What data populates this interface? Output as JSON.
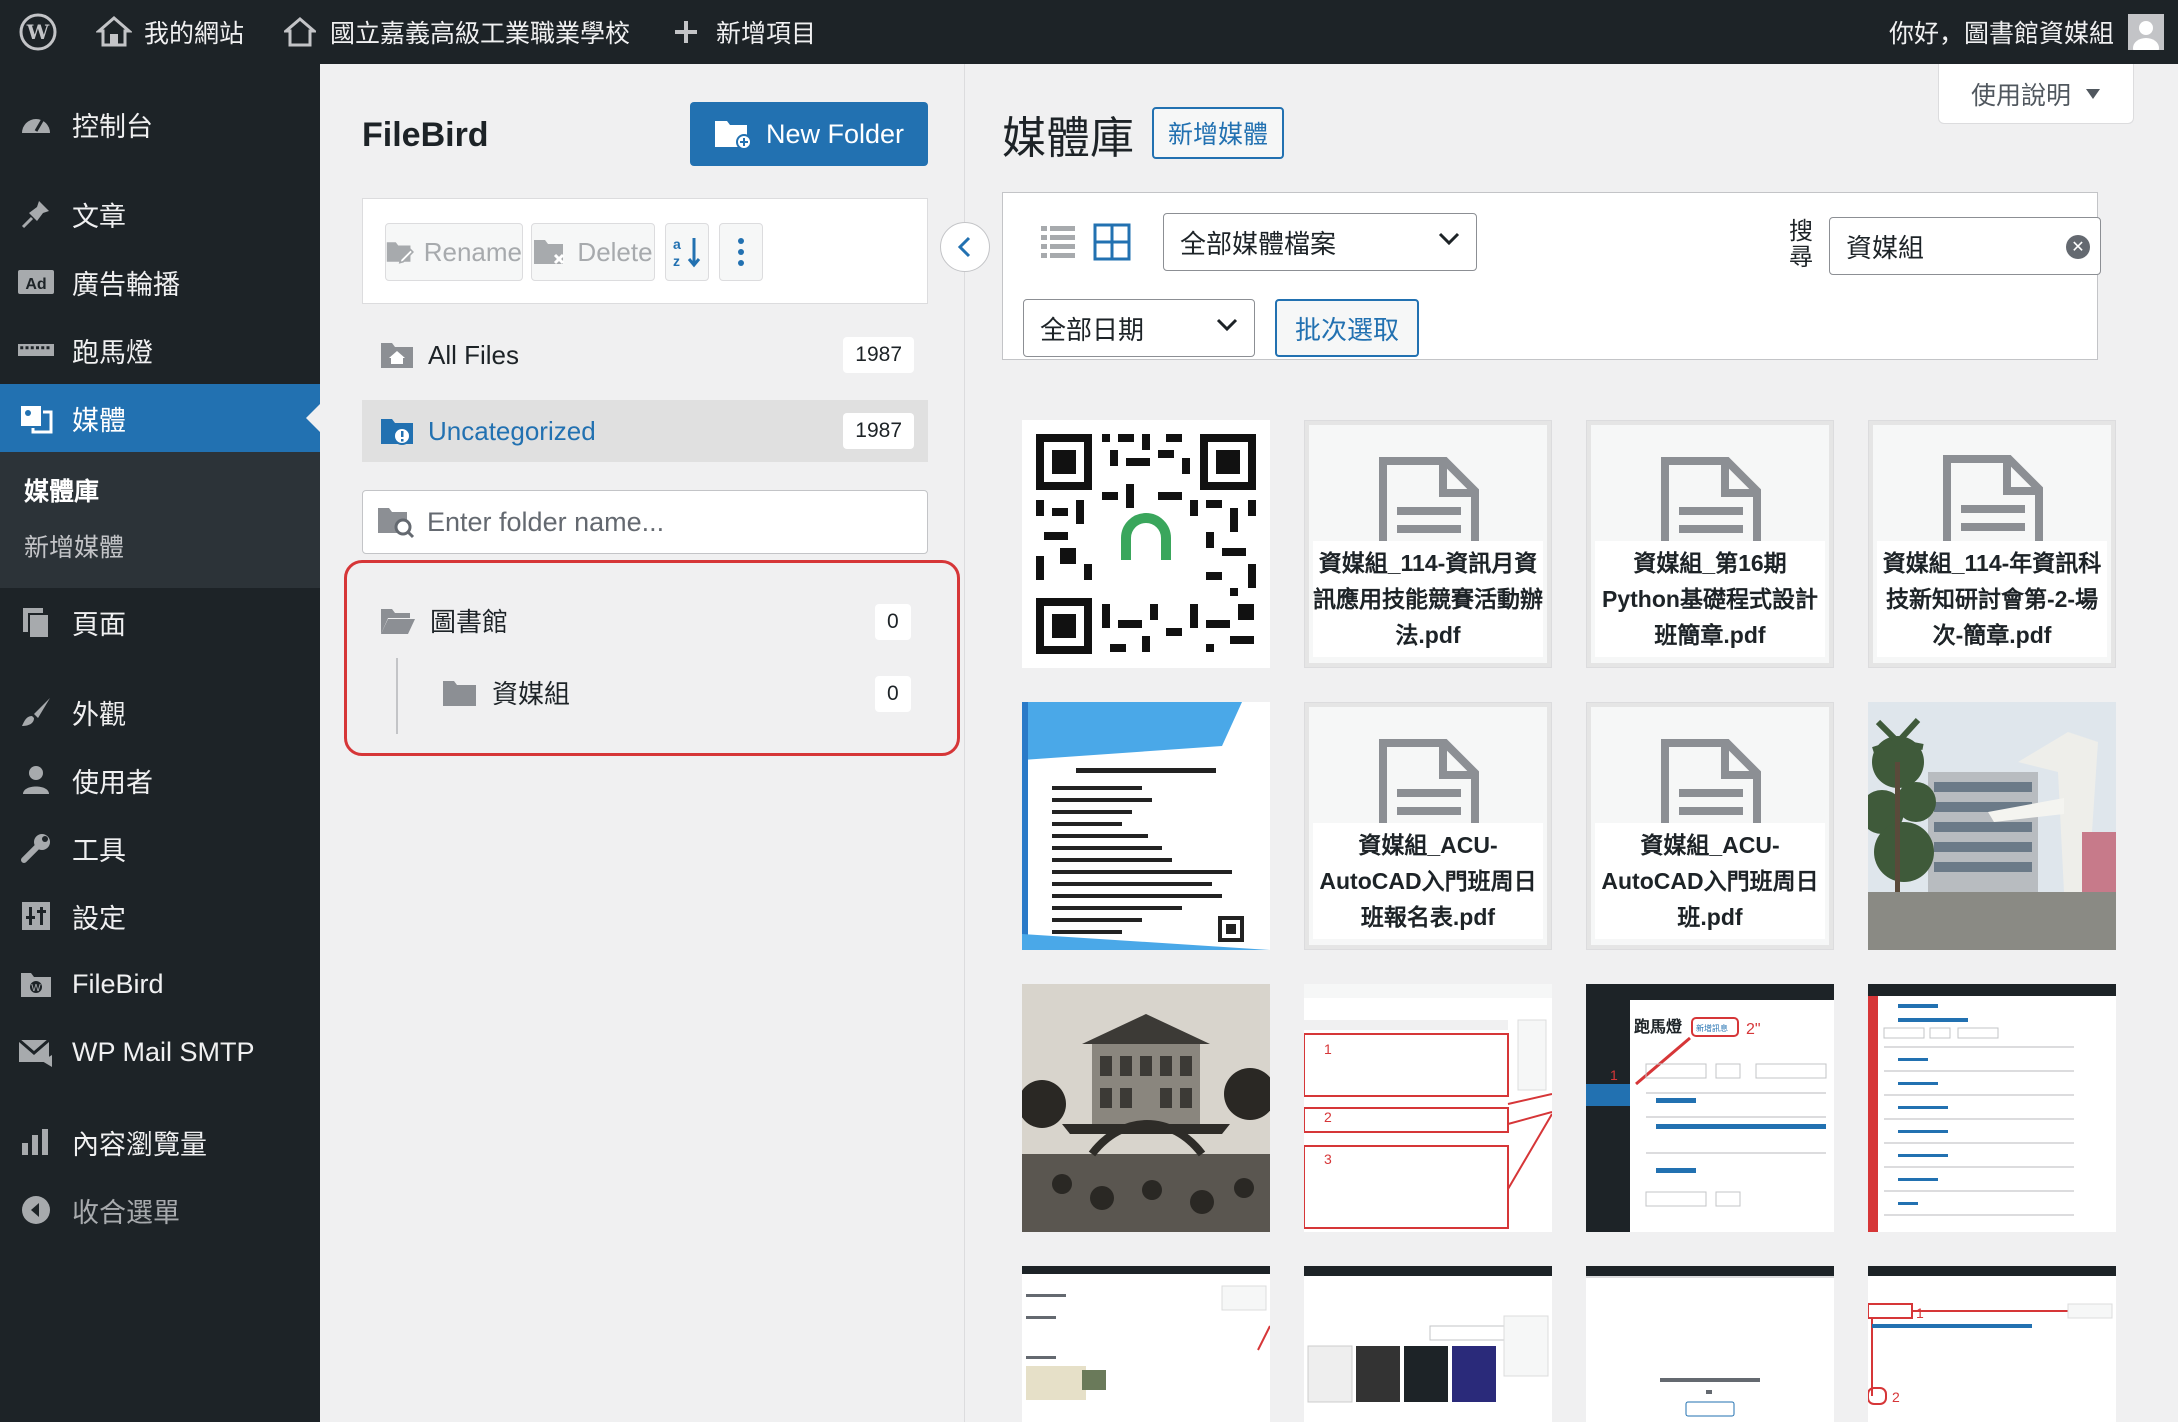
{
  "adminbar": {
    "site_name": "我的網站",
    "school_name": "國立嘉義高級工業職業學校",
    "new_item": "新增項目",
    "greeting": "你好，圖書館資媒組"
  },
  "sidebar": {
    "items": [
      {
        "label": "控制台",
        "icon": "dashboard-icon"
      },
      {
        "label": "文章",
        "icon": "pin-icon"
      },
      {
        "label": "廣告輪播",
        "icon": "ad-icon"
      },
      {
        "label": "跑馬燈",
        "icon": "marquee-icon"
      },
      {
        "label": "媒體",
        "icon": "media-icon"
      },
      {
        "label": "頁面",
        "icon": "page-icon"
      },
      {
        "label": "外觀",
        "icon": "brush-icon"
      },
      {
        "label": "使用者",
        "icon": "user-icon"
      },
      {
        "label": "工具",
        "icon": "wrench-icon"
      },
      {
        "label": "設定",
        "icon": "settings-icon"
      },
      {
        "label": "FileBird",
        "icon": "filebird-icon"
      },
      {
        "label": "WP Mail SMTP",
        "icon": "mail-icon"
      },
      {
        "label": "內容瀏覽量",
        "icon": "chart-icon"
      },
      {
        "label": "收合選單",
        "icon": "collapse-icon"
      }
    ],
    "media_submenu": [
      "媒體庫",
      "新增媒體"
    ]
  },
  "filebird": {
    "title": "FileBird",
    "new_folder": "New Folder",
    "rename": "Rename",
    "delete": "Delete",
    "all_files": "All Files",
    "all_files_count": "1987",
    "uncategorized": "Uncategorized",
    "uncategorized_count": "1987",
    "search_placeholder": "Enter folder name...",
    "folders": [
      {
        "name": "圖書館",
        "count": "0"
      },
      {
        "name": "資媒組",
        "count": "0"
      }
    ]
  },
  "main": {
    "title": "媒體庫",
    "add_media": "新增媒體",
    "help": "使用說明",
    "type_filter": "全部媒體檔案",
    "date_filter": "全部日期",
    "bulk_select": "批次選取",
    "search_label": "搜尋",
    "search_value": "資媒組",
    "docs": [
      "資媒組_114-資訊月資訊應用技能競賽活動辦法.pdf",
      "資媒組_第16期Python基礎程式設計班簡章.pdf",
      "資媒組_114-年資訊科技新知研討會第-2-場次-簡章.pdf",
      "資媒組_ACU-AutoCAD入門班周日班報名表.pdf",
      "資媒組_ACU-AutoCAD入門班周日班.pdf"
    ],
    "flyer_title": "ACU AutoCAD入門班(周日班)",
    "screenshot_labels": {
      "marquee": "跑馬燈",
      "add_new": "新增訊息"
    }
  }
}
